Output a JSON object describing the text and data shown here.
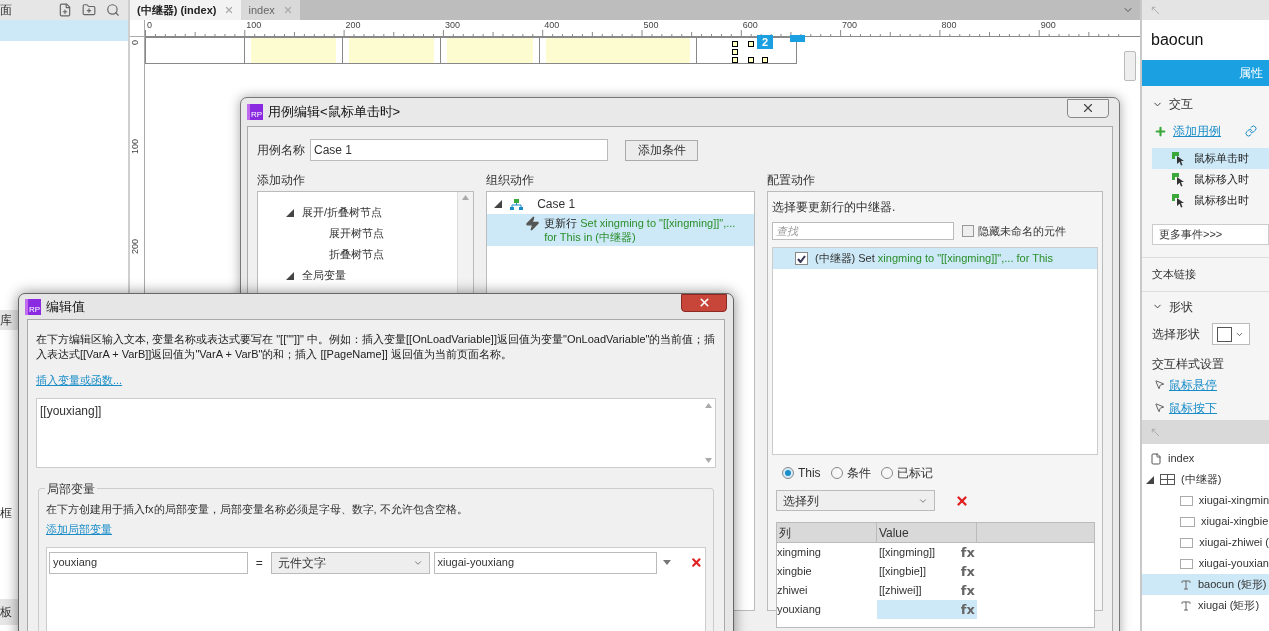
{
  "left_panel": {
    "title": "面",
    "cut_labels": [
      "库",
      "框",
      "板"
    ]
  },
  "tabs": [
    {
      "label": "(中继器) (index)",
      "selected": true
    },
    {
      "label": "index",
      "selected": false
    }
  ],
  "ruler": {
    "x_labels": [
      "0",
      "100",
      "200",
      "300",
      "400",
      "500",
      "600",
      "700",
      "800",
      "900"
    ],
    "y_labels": [
      "0",
      "100",
      "200"
    ]
  },
  "canvas": {
    "badge": "2"
  },
  "inspector": {
    "title": "baocun",
    "tab": "属性",
    "interaction": {
      "title": "交互",
      "expanded": true,
      "add_case": "添加用例",
      "events": [
        {
          "label": "鼠标单击时",
          "selected": true
        },
        {
          "label": "鼠标移入时",
          "selected": false
        },
        {
          "label": "鼠标移出时",
          "selected": false
        }
      ],
      "more_events": "更多事件>>>"
    },
    "text_link": "文本链接",
    "shape": {
      "title": "形状",
      "expanded": true,
      "select_label": "选择形状",
      "style_title": "交互样式设置",
      "style_links": [
        "鼠标悬停",
        "鼠标按下"
      ]
    }
  },
  "outline": [
    {
      "label": "index",
      "kind": "page"
    },
    {
      "label": "(中继器)",
      "kind": "repeater",
      "expanded": true,
      "children": [
        {
          "label": "xiugai-xingmin",
          "kind": "box",
          "selected": false
        },
        {
          "label": "xiugai-xingbie",
          "kind": "box",
          "selected": false
        },
        {
          "label": "xiugai-zhiwei (",
          "kind": "box",
          "selected": false
        },
        {
          "label": "xiugai-youxian",
          "kind": "box",
          "selected": false
        },
        {
          "label": "baocun (矩形)",
          "kind": "text",
          "selected": true
        },
        {
          "label": "xiugai (矩形)",
          "kind": "text",
          "selected": false
        }
      ]
    }
  ],
  "case_dialog": {
    "logo": "RP",
    "title": "用例编辑<鼠标单击时>",
    "name_label": "用例名称",
    "name_value": "Case 1",
    "add_condition": "添加条件",
    "add_actions": {
      "title": "添加动作",
      "tree": [
        {
          "label": "展开/折叠树节点",
          "expanded": true,
          "children": [
            {
              "label": "展开树节点"
            },
            {
              "label": "折叠树节点"
            }
          ]
        },
        {
          "label": "全局变量",
          "expanded": true
        }
      ]
    },
    "organize": {
      "title": "组织动作",
      "case": {
        "label": "Case 1",
        "expanded": true
      },
      "actions": [
        {
          "label": "更新行",
          "detail": "Set xingming to \"[[xingming]]\",... for This in (中继器)",
          "selected": true
        }
      ]
    },
    "configure": {
      "title": "配置动作",
      "prompt": "选择要更新行的中继器.",
      "search_placeholder": "查找",
      "hide_unnamed": {
        "label": "隐藏未命名的元件",
        "checked": false
      },
      "targets": [
        {
          "name": "(中继器) Set",
          "detail": "xingming to \"[[xingming]]\",... for This",
          "checked": true,
          "selected": true
        }
      ],
      "scope": [
        {
          "label": "This",
          "selected": true
        },
        {
          "label": "条件",
          "selected": false
        },
        {
          "label": "已标记",
          "selected": false
        }
      ],
      "column_select": "选择列",
      "columns": [
        "列",
        "Value"
      ],
      "rows": [
        {
          "column": "xingming",
          "value": "[[xingming]]",
          "fx": "fx",
          "selected": false
        },
        {
          "column": "xingbie",
          "value": "[[xingbie]]",
          "fx": "fx",
          "selected": false
        },
        {
          "column": "zhiwei",
          "value": "[[zhiwei]]",
          "fx": "fx",
          "selected": false
        },
        {
          "column": "youxiang",
          "fx": "fx",
          "selected": true
        }
      ]
    }
  },
  "value_dialog": {
    "logo": "RP",
    "title": "编辑值",
    "description": "在下方编辑区输入文本, 变量名称或表达式要写在 \"[[\"\"]]\" 中。例如：插入变量[[OnLoadVariable]]返回值为变量\"OnLoadVariable\"的当前值；插入表达式[[VarA + VarB]]返回值为\"VarA + VarB\"的和；插入 [[PageName]] 返回值为当前页面名称。",
    "insert_link": "插入变量或函数...",
    "value": "[[youxiang]]",
    "local_vars": {
      "title": "局部变量",
      "description": "在下方创建用于插入fx的局部变量，局部变量名称必须是字母、数字, 不允许包含空格。",
      "add_link": "添加局部变量",
      "rows": [
        {
          "name": "youxiang",
          "equals": "=",
          "type": "元件文字",
          "target": "xiugai-youxiang"
        }
      ]
    }
  }
}
